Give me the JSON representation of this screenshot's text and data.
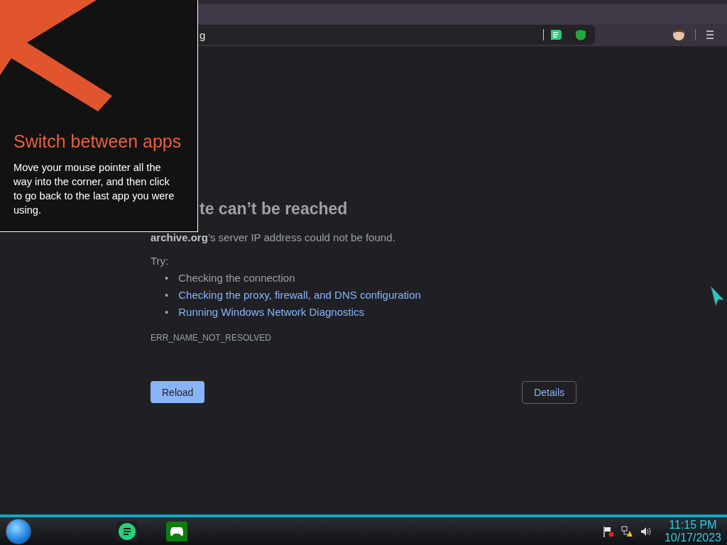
{
  "browser": {
    "address_bar": {
      "value": "g"
    }
  },
  "overlay_tip": {
    "title": "Switch between apps",
    "body": "Move your mouse pointer all the way into the corner, and then click to go back to the last app you were using."
  },
  "error_page": {
    "heading": "te can’t be reached",
    "message": "**archive.org**’s server IP address could not be found.",
    "try_label": "Try:",
    "suggestions": [
      {
        "bullet": "•",
        "text": "Checking the connection",
        "kind": "plain"
      },
      {
        "bullet": "•",
        "text": "Checking the proxy, firewall, and DNS configuration",
        "kind": "link"
      },
      {
        "bullet": "•",
        "text": "Running Windows Network Diagnostics",
        "kind": "link"
      }
    ],
    "error_code": "ERR_NAME_NOT_RESOLVED",
    "buttons": [
      {
        "label": "Reload",
        "kind": "primary"
      },
      {
        "label": "Details",
        "kind": "outline"
      }
    ]
  },
  "taskbar": {
    "time": "11:15 PM",
    "date": "10/17/2023"
  }
}
